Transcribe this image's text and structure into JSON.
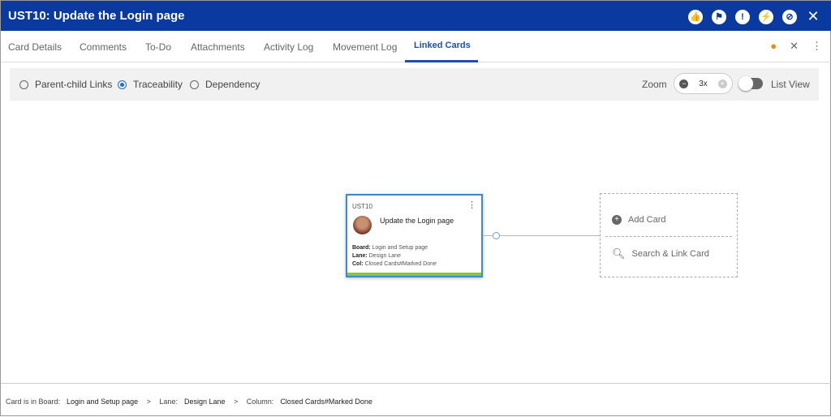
{
  "header": {
    "title": "UST10:  Update the Login page",
    "icons": [
      "thumbs-up-icon",
      "flag-icon",
      "alert-icon",
      "lightning-icon",
      "block-icon",
      "close-icon"
    ]
  },
  "tabs": [
    {
      "label": "Card Details"
    },
    {
      "label": "Comments"
    },
    {
      "label": "To-Do"
    },
    {
      "label": "Attachments"
    },
    {
      "label": "Activity Log"
    },
    {
      "label": "Movement Log"
    },
    {
      "label": "Linked Cards"
    }
  ],
  "view": {
    "radios": [
      {
        "label": "Parent-child Links",
        "checked": false
      },
      {
        "label": "Traceability",
        "checked": true
      },
      {
        "label": "Dependency",
        "checked": false
      }
    ],
    "zoom_label": "Zoom",
    "zoom_value": "3x",
    "list_view": "List View",
    "list_view_on": false
  },
  "card": {
    "id": "UST10",
    "title": "Update the Login page",
    "board_label": "Board:",
    "board": "Login and Setup page",
    "lane_label": "Lane:",
    "lane": "Design Lane",
    "col_label": "Col:",
    "col": "Closed Cards#Marked Done",
    "accent": "#8cc43c"
  },
  "actions": {
    "add": "Add Card",
    "search": "Search & Link Card"
  },
  "footer": {
    "board_label": "Card is in Board:",
    "board": "Login and Setup page",
    "lane_label": "Lane:",
    "lane": "Design Lane",
    "col_label": "Column:",
    "col": "Closed Cards#Marked Done",
    "sep": ">"
  }
}
